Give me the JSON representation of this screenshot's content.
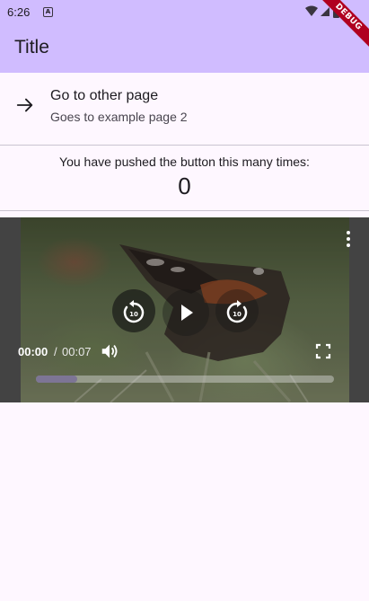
{
  "status_bar": {
    "time": "6:26",
    "notification_letter": "A"
  },
  "debug_banner": "DEBUG",
  "app_bar": {
    "title": "Title"
  },
  "list_tile": {
    "title": "Go to other page",
    "subtitle": "Goes to example page 2",
    "icon": "arrow-forward-icon"
  },
  "counter": {
    "label": "You have pushed the button this many times:",
    "value": "0"
  },
  "video_player": {
    "position": "00:00",
    "separator": "/",
    "duration": "00:07",
    "progress": 0.14,
    "rewind_seconds": "10",
    "forward_seconds": "10",
    "icons": [
      "replay-10-icon",
      "play-icon",
      "forward-10-icon",
      "more-vert-icon",
      "volume-icon",
      "fullscreen-icon"
    ]
  },
  "colors": {
    "app_bar": "#d0bcff",
    "background": "#fef7ff",
    "divider": "#cac4d0",
    "debug_banner": "#b00020"
  }
}
